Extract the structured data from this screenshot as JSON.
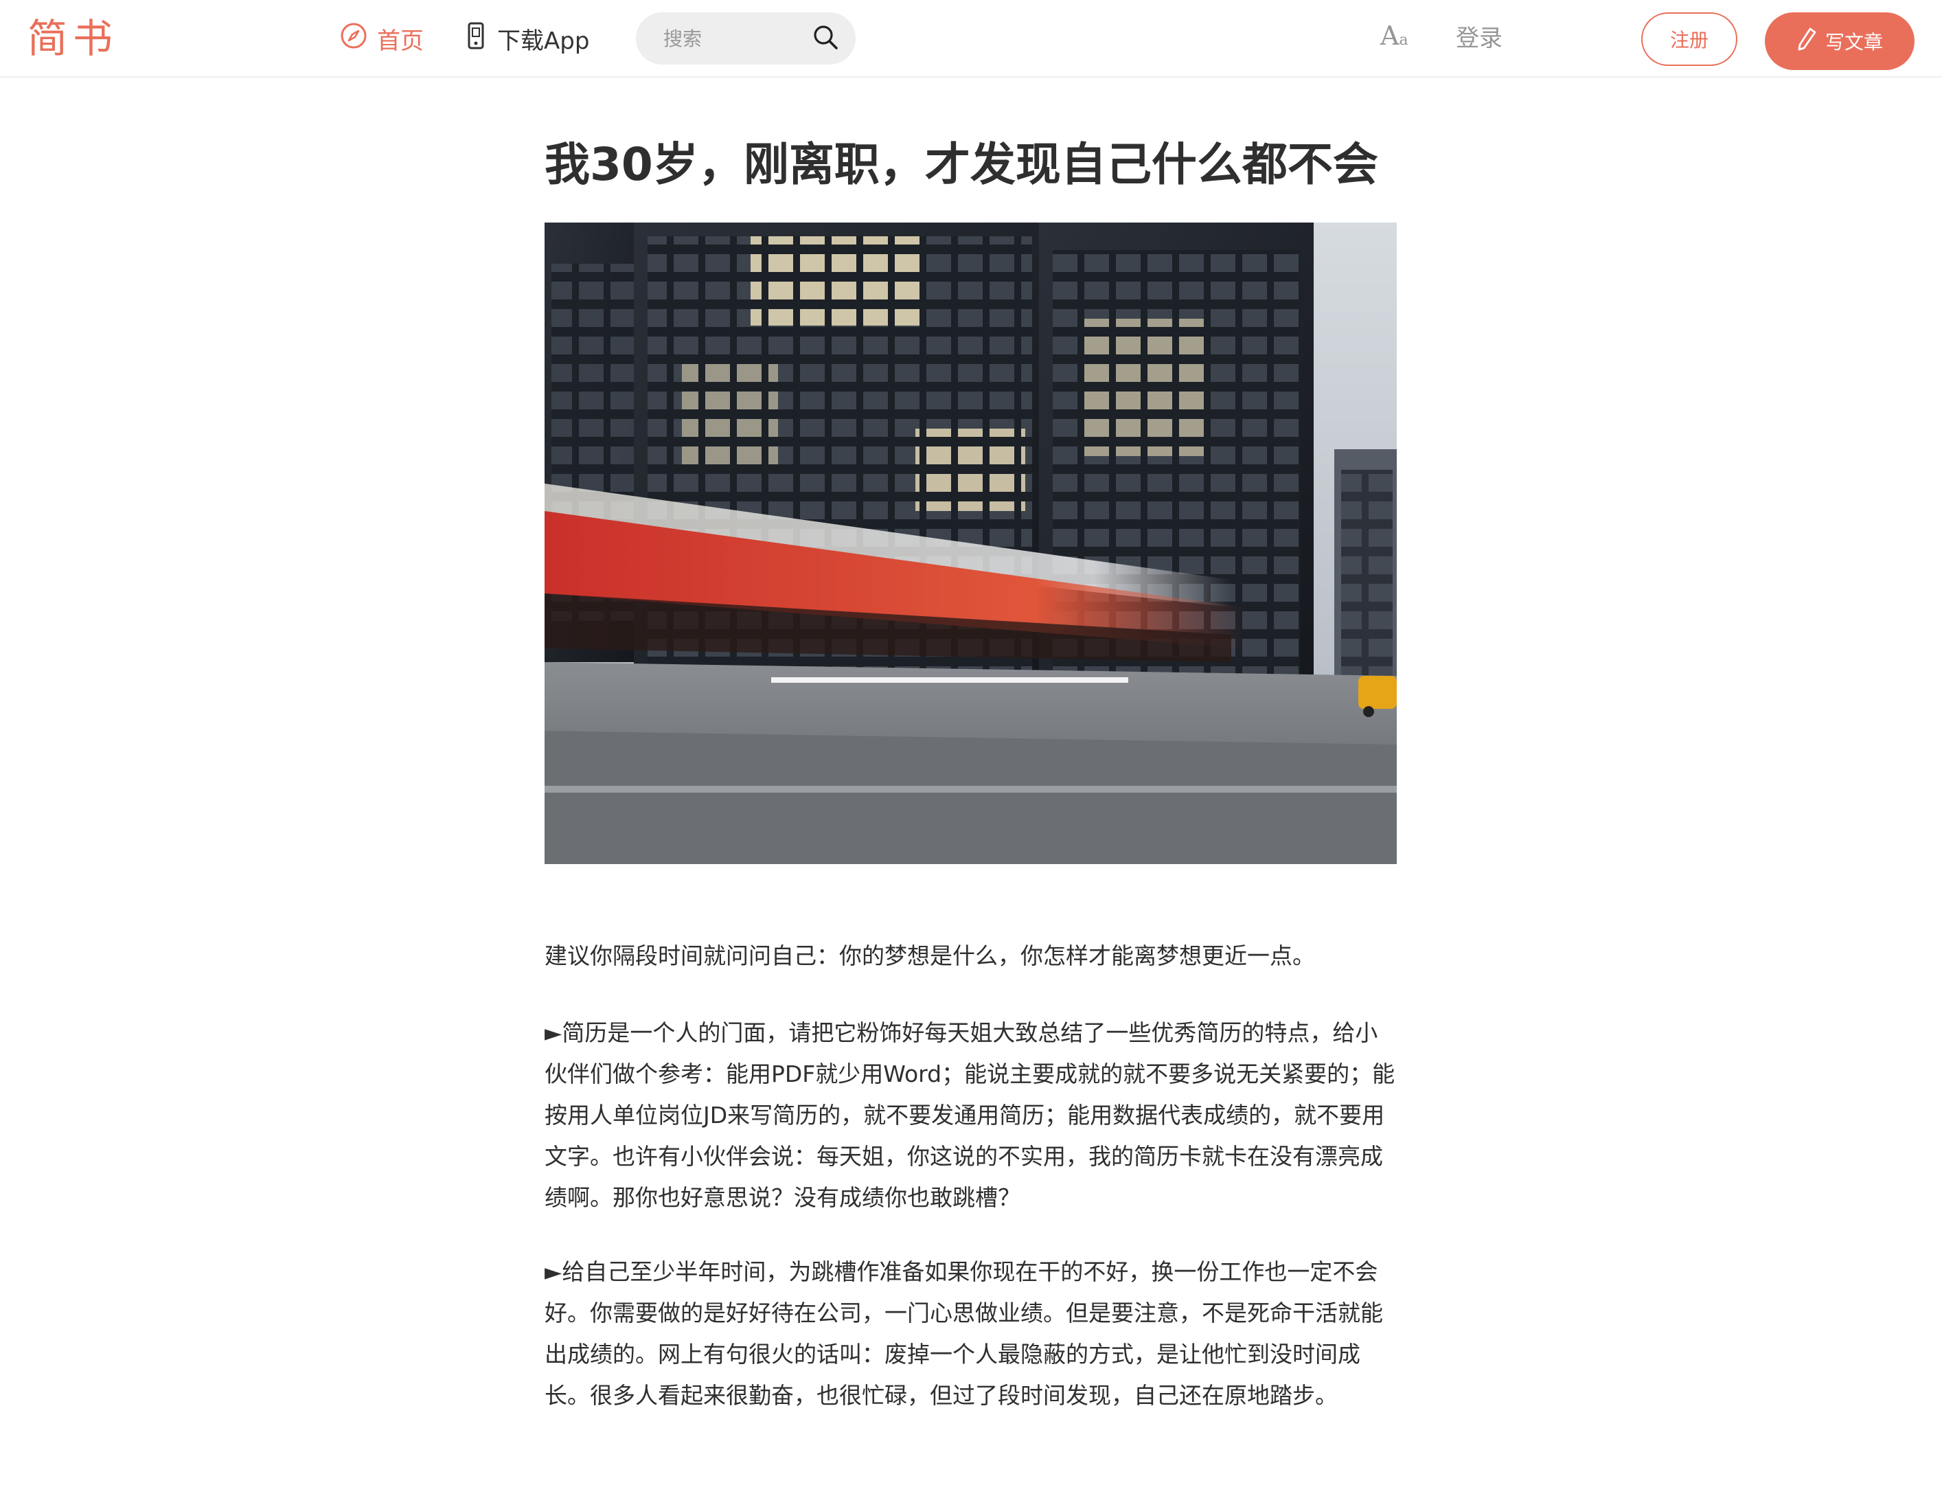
{
  "header": {
    "logo": "简书",
    "nav_home": "首页",
    "nav_app": "下载App",
    "search_placeholder": "搜索",
    "font_toggle_big": "A",
    "font_toggle_small": "a",
    "login": "登录",
    "register": "注册",
    "write": "写文章"
  },
  "colors": {
    "accent": "#ea6f5a",
    "text": "#2f2f2f",
    "muted": "#969696",
    "search_bg": "#eeeeee"
  },
  "icons": {
    "home": "compass-icon",
    "app": "mobile-phone-icon",
    "search": "search-icon",
    "write": "pencil-icon"
  },
  "article": {
    "title": "我30岁，刚离职，才发现自己什么都不会",
    "paragraphs": [
      "建议你隔段时间就问问自己：你的梦想是什么，你怎样才能离梦想更近一点。",
      "►简历是一个人的门面，请把它粉饰好每天姐大致总结了一些优秀简历的特点，给小伙伴们做个参考：能用PDF就少用Word；能说主要成就的就不要多说无关紧要的；能按用人单位岗位JD来写简历的，就不要发通用简历；能用数据代表成绩的，就不要用文字。也许有小伙伴会说：每天姐，你这说的不实用，我的简历卡就卡在没有漂亮成绩啊。那你也好意思说？没有成绩你也敢跳槽？",
      "►给自己至少半年时间，为跳槽作准备如果你现在干的不好，换一份工作也一定不会好。你需要做的是好好待在公司，一门心思做业绩。但是要注意，不是死命干活就能出成绩的。网上有句很火的话叫：废掉一个人最隐蔽的方式，是让他忙到没时间成长。很多人看起来很勤奋，也很忙碌，但过了段时间发现，自己还在原地踏步。"
    ]
  }
}
